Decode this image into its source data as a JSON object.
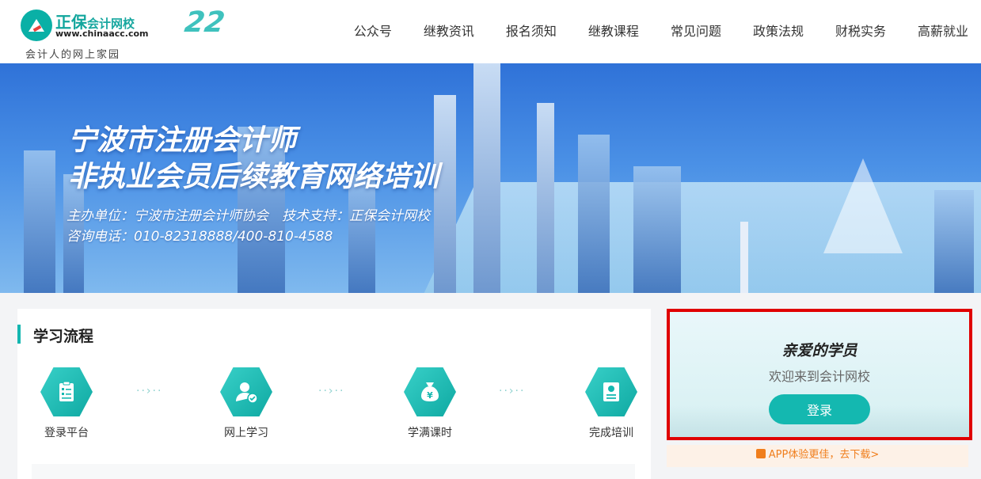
{
  "header": {
    "logo": {
      "brand_main": "正保",
      "brand_sub": "会计网校",
      "url": "www.chinaacc.com",
      "slogan": "会计人的网上家园"
    },
    "anniversary": "22",
    "nav": [
      "公众号",
      "继教资讯",
      "报名须知",
      "继教课程",
      "常见问题",
      "政策法规",
      "财税实务",
      "高薪就业"
    ]
  },
  "banner": {
    "title_line1": "宁波市注册会计师",
    "title_line2": "非执业会员后续教育网络培训",
    "organizer": "主办单位：宁波市注册会计师协会　技术支持：正保会计网校",
    "hotline": "咨询电话：010-82318888/400-810-4588"
  },
  "process": {
    "heading": "学习流程",
    "steps": [
      {
        "label": "登录平台",
        "icon": "clipboard-icon"
      },
      {
        "label": "网上学习",
        "icon": "user-check-icon"
      },
      {
        "label": "学满课时",
        "icon": "money-bag-icon"
      },
      {
        "label": "完成培训",
        "icon": "certificate-icon"
      }
    ],
    "arrow": "··›··"
  },
  "login": {
    "greeting": "亲爱的学员",
    "welcome": "欢迎来到会计网校",
    "button_label": "登录"
  },
  "app_promo": {
    "text": "APP体验更佳，去下载>"
  },
  "colors": {
    "accent": "#14b8b0",
    "highlight_border": "#e00000",
    "promo_text": "#f07e1c"
  }
}
